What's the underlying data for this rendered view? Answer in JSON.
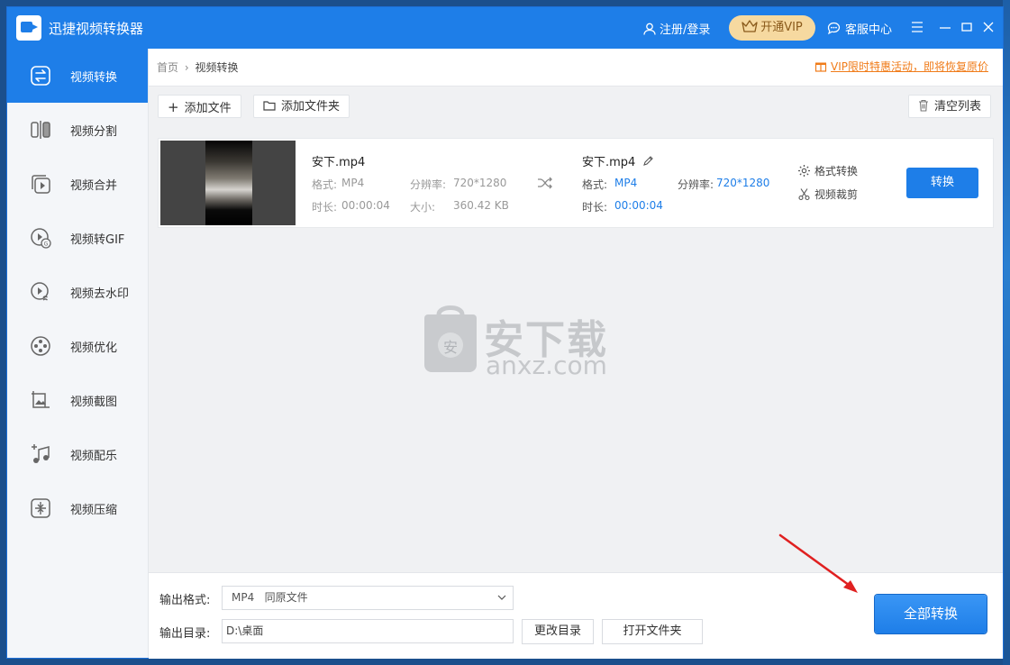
{
  "app": {
    "title": "迅捷视频转换器",
    "user_link": "注册/登录",
    "vip_label": "开通VIP",
    "service_label": "客服中心"
  },
  "sidebar": {
    "items": [
      {
        "label": "视频转换",
        "icon": "convert-icon",
        "active": true
      },
      {
        "label": "视频分割",
        "icon": "split-icon"
      },
      {
        "label": "视频合并",
        "icon": "merge-icon"
      },
      {
        "label": "视频转GIF",
        "icon": "gif-icon"
      },
      {
        "label": "视频去水印",
        "icon": "watermark-icon"
      },
      {
        "label": "视频优化",
        "icon": "optimize-icon"
      },
      {
        "label": "视频截图",
        "icon": "screenshot-icon"
      },
      {
        "label": "视频配乐",
        "icon": "music-icon"
      },
      {
        "label": "视频压缩",
        "icon": "compress-icon"
      }
    ]
  },
  "breadcrumb": {
    "home": "首页",
    "sep": "›",
    "current": "视频转换"
  },
  "promo": "VIP限时特惠活动，即将恢复原价",
  "toolbar": {
    "add_file": "添加文件",
    "add_folder": "添加文件夹",
    "clear_list": "清空列表"
  },
  "file": {
    "name": "安下.mp4",
    "format_label": "格式:",
    "format": "MP4",
    "resolution_label": "分辨率:",
    "resolution": "720*1280",
    "duration_label": "时长:",
    "duration": "00:00:04",
    "size_label": "大小:",
    "size": "360.42 KB",
    "output_name": "安下.mp4",
    "output_format": "MP4",
    "output_resolution": "720*1280",
    "output_duration": "00:00:04",
    "format_convert": "格式转换",
    "video_crop": "视频裁剪",
    "convert_button": "转换"
  },
  "watermark": {
    "text_cn": "安下载",
    "text_en": "anxz.com",
    "badge": "安"
  },
  "bottom": {
    "output_format_label": "输出格式:",
    "output_format_value": "MP4   同原文件",
    "output_dir_label": "输出目录:",
    "output_dir_value": "D:\\桌面",
    "change_dir": "更改目录",
    "open_folder": "打开文件夹",
    "convert_all": "全部转换"
  },
  "colors": {
    "brand": "#1e7ee8",
    "promo": "#f07c1a",
    "vip_bg": "#f6d9a0",
    "arrow": "#e02020"
  }
}
